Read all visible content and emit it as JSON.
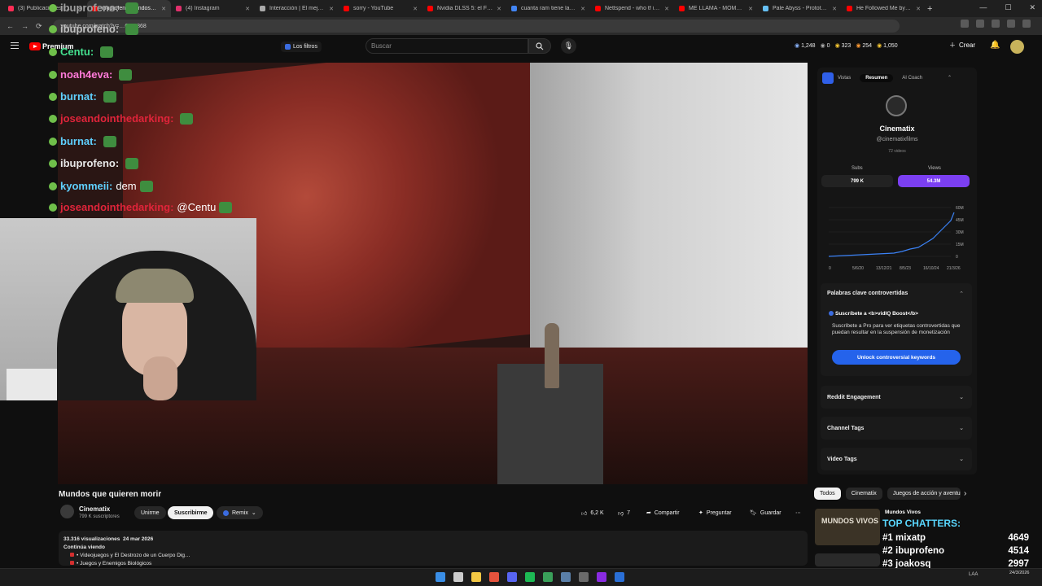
{
  "browser": {
    "tabs": [
      {
        "label": "(3) Publicaciones | …",
        "color": "#ff2d55",
        "active": false
      },
      {
        "label": "ibuprofeno Mundos que quieren…",
        "color": "#ff0000",
        "active": true
      },
      {
        "label": "(4) Instagram",
        "color": "#e1306c",
        "active": false
      },
      {
        "label": "Interacción | El mejor softw…",
        "color": "#aaaaaa",
        "active": false
      },
      {
        "label": "sorry - YouTube",
        "color": "#ff0000",
        "active": false
      },
      {
        "label": "Nvidia DLSS 5: el FILTRO…",
        "color": "#ff0000",
        "active": false
      },
      {
        "label": "cuanta ram tiene la ps3 -…",
        "color": "#4285f4",
        "active": false
      },
      {
        "label": "Nettspend - who tf is u (…",
        "color": "#ff0000",
        "active": false
      },
      {
        "label": "ME LLAMA - MOMO (Bern…",
        "color": "#ff0000",
        "active": false
      },
      {
        "label": "Pale Abyss - Prototype en…",
        "color": "#66c0f4",
        "active": false
      },
      {
        "label": "He Followed Me by Zest…",
        "color": "#ff0000",
        "active": false
      }
    ],
    "url": "youtube.com/watch?v=…QMx868"
  },
  "youtube": {
    "logo_text": "Premium",
    "filters_label": "Los filtros",
    "search_placeholder": "Buscar",
    "stats": [
      "1,248",
      "0",
      "323",
      "254",
      "1,050"
    ],
    "create_label": "Crear",
    "video": {
      "title": "Mundos que quieren morir",
      "channel": "Cinematix",
      "subscribers": "799 K suscriptores",
      "join_label": "Unirme",
      "subscribe_label": "Suscribirme",
      "remix_label": "Remix",
      "likes": "6,2 K",
      "dislikes": "7",
      "share_label": "Compartir",
      "ask_label": "Preguntar",
      "save_label": "Guardar",
      "views": "33.316 visualizaciones",
      "date": "24 mar 2026",
      "continue_label": "Continúa viendo",
      "desc_items": [
        "• Videojuegos y El Destrozo de un Cuerpo Dig…",
        "• Juegos y Enemigos Biológicos"
      ]
    },
    "chips": [
      "Todos",
      "Cinematix",
      "Juegos de acción y aventura"
    ],
    "related": [
      {
        "title": "Mundos Vivos",
        "thumb_text": "MUNDOS VIVOS"
      }
    ]
  },
  "stream_chat": [
    {
      "user": "ibuprofeno:",
      "color": "#a0a0a0",
      "msg": ""
    },
    {
      "user": "ibuprofeno:",
      "color": "#bfbfbf",
      "msg": ""
    },
    {
      "user": "Centu:",
      "color": "#44e08f",
      "msg": ""
    },
    {
      "user": "noah4eva:",
      "color": "#ff7ad9",
      "msg": ""
    },
    {
      "user": "burnat:",
      "color": "#5fd0ff",
      "msg": ""
    },
    {
      "user": "joseandointhedarking:",
      "color": "#e0243a",
      "msg": ""
    },
    {
      "user": "burnat:",
      "color": "#5fd0ff",
      "msg": ""
    },
    {
      "user": "ibuprofeno:",
      "color": "#e8e8e8",
      "msg": ""
    },
    {
      "user": "kyommeii:",
      "color": "#5fd0ff",
      "msg": "dem"
    },
    {
      "user": "joseandointhedarking:",
      "color": "#e0243a",
      "msg": "@Centu"
    }
  ],
  "vidiq": {
    "tabs": [
      "Vistas",
      "Resumen",
      "AI Coach"
    ],
    "active_tab": "Resumen",
    "channel_name": "Cinematix",
    "handle": "@cinematixfilms",
    "videos": "72 videos",
    "subs_label": "Subs",
    "views_label": "Views",
    "subs_value": "799 K",
    "views_value": "54.3M",
    "accent": "#7b3ff2",
    "graph": {
      "y_ticks": [
        "60M",
        "45M",
        "30M",
        "15M",
        "0"
      ],
      "x_ticks": [
        "0",
        "5/6/20",
        "13/12/21",
        "8/5/23",
        "16/10/24",
        "21/3/26"
      ],
      "line_color": "#3b82f6"
    },
    "keywords": {
      "header": "Palabras clave controvertidas",
      "title": "Suscríbete a <b>vidIQ Boost</b>",
      "text": "Suscríbete a Pro para ver etiquetas controvertidas que puedan resultar en la suspensión de monetización",
      "button": "Unlock controversial keywords"
    },
    "sections": [
      "Reddit Engagement",
      "Channel Tags",
      "Video Tags"
    ]
  },
  "top_chatters": {
    "title": "TOP CHATTERS:",
    "rows": [
      {
        "rank": "#1",
        "name": "mixatp",
        "count": "4649"
      },
      {
        "rank": "#2",
        "name": "ibuprofeno",
        "count": "4514"
      },
      {
        "rank": "#3",
        "name": "joakosq",
        "count": "2997"
      }
    ]
  },
  "taskbar": {
    "icons": [
      "windows-icon",
      "search-icon",
      "file-explorer-icon",
      "chrome-icon",
      "discord-icon",
      "spotify-icon",
      "terminal-icon",
      "steam-icon",
      "app-icon",
      "obs-icon",
      "app-icon-2"
    ],
    "lang": "LAA",
    "date": "24/3/2026"
  }
}
